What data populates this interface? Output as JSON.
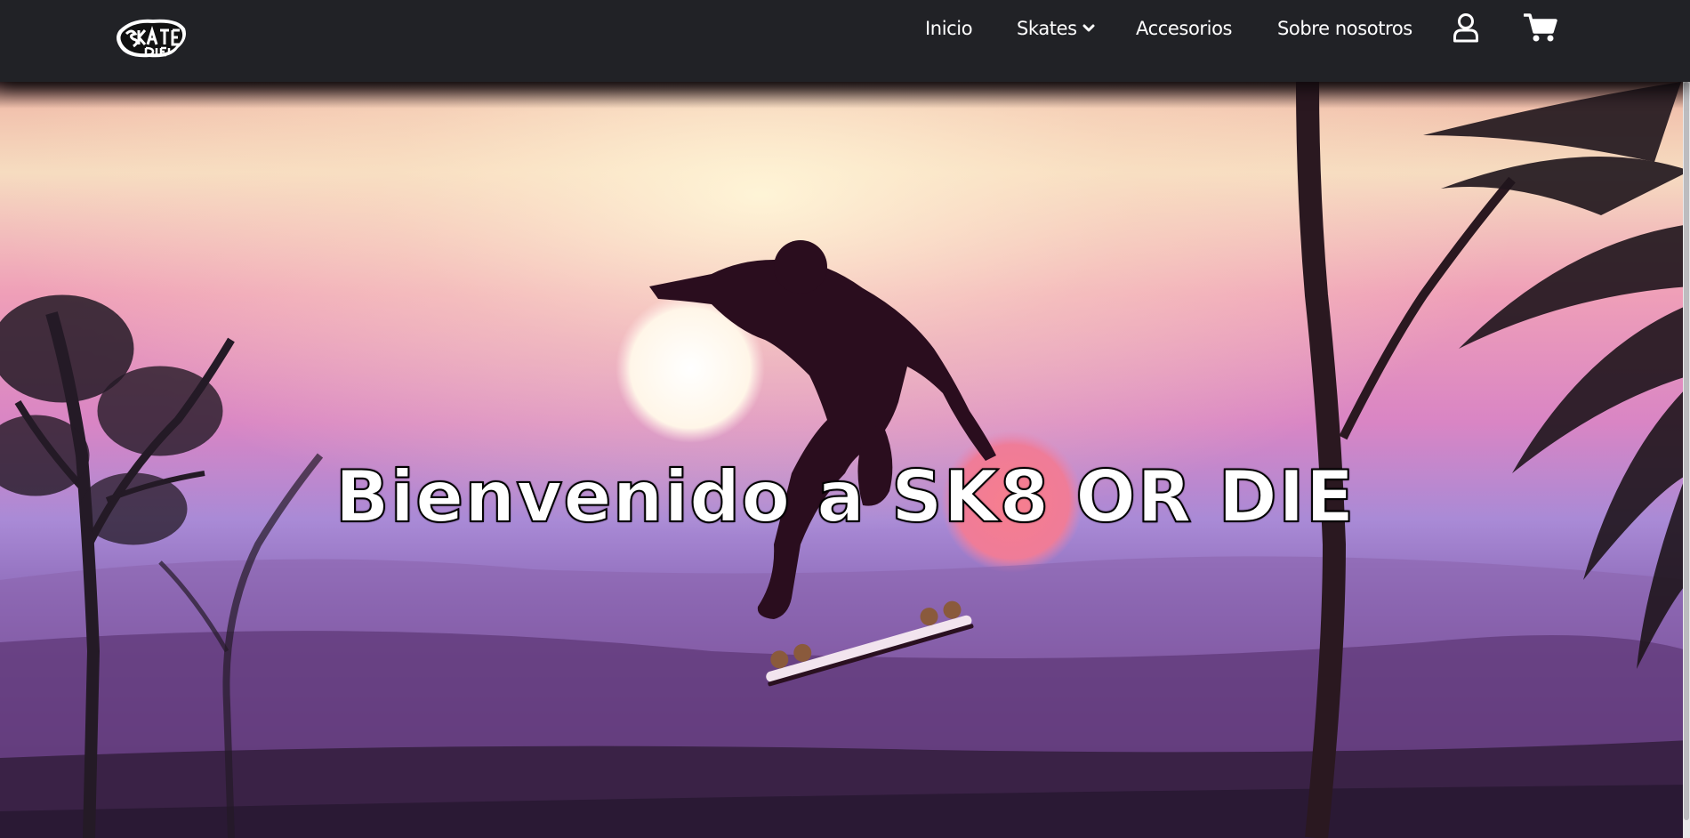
{
  "logo": {
    "alt": "SKATE OR DIE!",
    "icon": "skate-or-die-logo"
  },
  "nav": {
    "items": [
      {
        "label": "Inicio"
      },
      {
        "label": "Skates",
        "dropdown_icon": "chevron-down-icon"
      },
      {
        "label": "Accesorios"
      },
      {
        "label": "Sobre nosotros"
      }
    ],
    "user_icon": "user-icon",
    "cart_icon": "cart-icon"
  },
  "hero": {
    "title": "Bienvenido a SK8 OR DIE",
    "image_alt": "Skater haciendo un truco al atardecer"
  },
  "colors": {
    "navbar": "#212226",
    "nav_text": "#ffffff",
    "sky_top": "#f6e6c6",
    "sky_mid": "#e889b4",
    "haze": "#9a70c6",
    "ground": "#3f2a4c"
  }
}
